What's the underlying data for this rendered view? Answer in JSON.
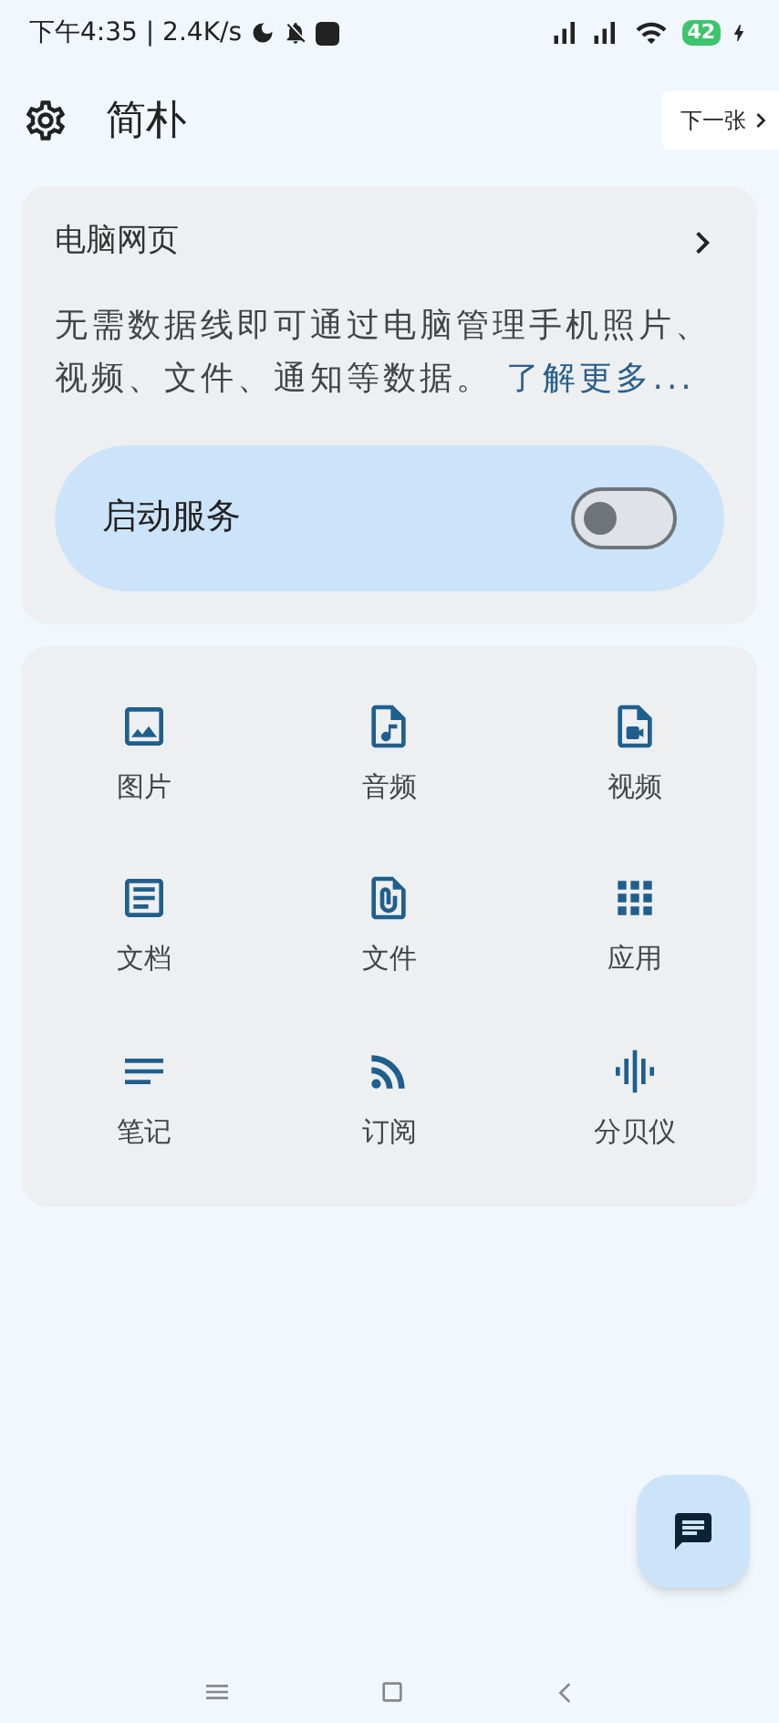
{
  "status_bar": {
    "time": "下午4:35 | 2.4K/s",
    "battery": "42"
  },
  "header": {
    "title": "简朴",
    "next_button": "下一张"
  },
  "web_card": {
    "title": "电脑网页",
    "description": "无需数据线即可通过电脑管理手机照片、视频、文件、通知等数据。",
    "link": "了解更多...",
    "service": {
      "label": "启动服务",
      "on": false
    }
  },
  "grid": [
    {
      "label": "图片"
    },
    {
      "label": "音频"
    },
    {
      "label": "视频"
    },
    {
      "label": "文档"
    },
    {
      "label": "文件"
    },
    {
      "label": "应用"
    },
    {
      "label": "笔记"
    },
    {
      "label": "订阅"
    },
    {
      "label": "分贝仪"
    }
  ]
}
